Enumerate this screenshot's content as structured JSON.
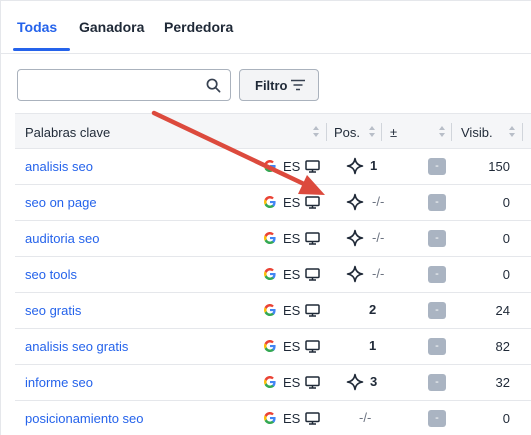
{
  "tabs": [
    {
      "label": "Todas",
      "active": true
    },
    {
      "label": "Ganadora",
      "active": false
    },
    {
      "label": "Perdedora",
      "active": false
    }
  ],
  "search": {
    "value": "",
    "placeholder": "",
    "icon": "search-icon"
  },
  "filter": {
    "label": "Filtro",
    "icon": "filter-lines-icon"
  },
  "table": {
    "headers": {
      "keyword": "Palabras clave",
      "position": "Pos.",
      "diff": "±",
      "visibility": "Visib."
    },
    "rows": [
      {
        "keyword": "analisis seo",
        "engine": "google-icon",
        "locale": "ES",
        "device": "desktop-icon",
        "feature": true,
        "position": "1",
        "diff": "-",
        "visibility": "150"
      },
      {
        "keyword": "seo on page",
        "engine": "google-icon",
        "locale": "ES",
        "device": "desktop-icon",
        "feature": true,
        "position": "-/-",
        "diff": "-",
        "visibility": "0"
      },
      {
        "keyword": "auditoria seo",
        "engine": "google-icon",
        "locale": "ES",
        "device": "desktop-icon",
        "feature": true,
        "position": "-/-",
        "diff": "-",
        "visibility": "0"
      },
      {
        "keyword": "seo tools",
        "engine": "google-icon",
        "locale": "ES",
        "device": "desktop-icon",
        "feature": true,
        "position": "-/-",
        "diff": "-",
        "visibility": "0"
      },
      {
        "keyword": "seo gratis",
        "engine": "google-icon",
        "locale": "ES",
        "device": "desktop-icon",
        "feature": false,
        "position": "2",
        "diff": "-",
        "visibility": "24"
      },
      {
        "keyword": "analisis seo gratis",
        "engine": "google-icon",
        "locale": "ES",
        "device": "desktop-icon",
        "feature": false,
        "position": "1",
        "diff": "-",
        "visibility": "82"
      },
      {
        "keyword": "informe seo",
        "engine": "google-icon",
        "locale": "ES",
        "device": "desktop-icon",
        "feature": true,
        "position": "3",
        "diff": "-",
        "visibility": "32"
      },
      {
        "keyword": "posicionamiento seo",
        "engine": "google-icon",
        "locale": "ES",
        "device": "desktop-icon",
        "feature": false,
        "position": "-/-",
        "diff": "-",
        "visibility": "0"
      }
    ]
  },
  "colors": {
    "accent": "#2563eb",
    "annotation_arrow": "#dc4a3d",
    "diff_badge": "#aab4c2"
  }
}
